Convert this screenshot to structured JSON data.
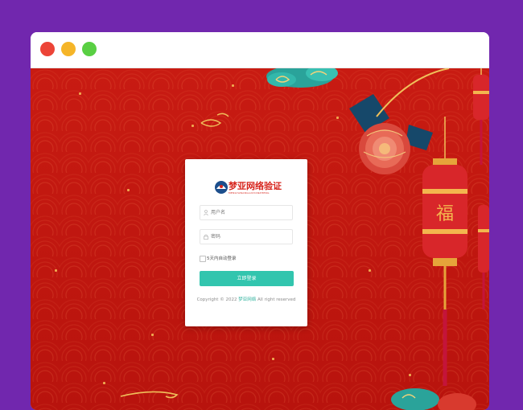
{
  "window": {
    "controls": [
      "close",
      "minimize",
      "maximize"
    ]
  },
  "login": {
    "logo_title": "梦亚网络验证",
    "logo_subtitle": "MENGYAWANGLUOYANZHENG",
    "username_placeholder": "用户名",
    "password_placeholder": "密码",
    "remember_label": "5天内自动登录",
    "submit_label": "立即登录",
    "copyright_prefix": "Copyright © 2022",
    "copyright_link": "梦亚网络",
    "copyright_suffix": "All right reserved"
  },
  "colors": {
    "page_background": "#7127ae",
    "scene_red": "#c4160f",
    "accent_teal": "#32c5ae",
    "brand_red": "#d7241c"
  },
  "icons": {
    "username": "user-icon",
    "password": "lock-icon",
    "logo": "logo-emblem-icon"
  }
}
